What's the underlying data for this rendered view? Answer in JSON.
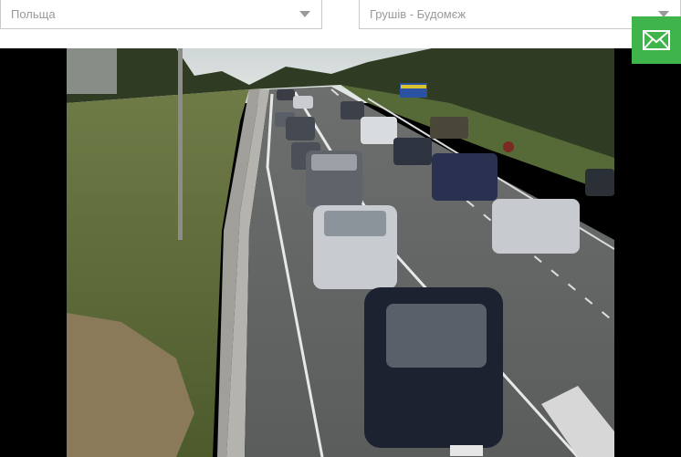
{
  "filters": {
    "country": {
      "value": "Польща"
    },
    "checkpoint": {
      "value": "Грушів - Будомєж"
    }
  },
  "contact": {
    "icon": "envelope-icon",
    "color": "#3fb44a"
  },
  "camera": {
    "feed_icon": "webcam-image"
  },
  "colors": {
    "select_text": "#9a9a9a",
    "select_border": "#c9c9c9",
    "background": "#000000"
  }
}
